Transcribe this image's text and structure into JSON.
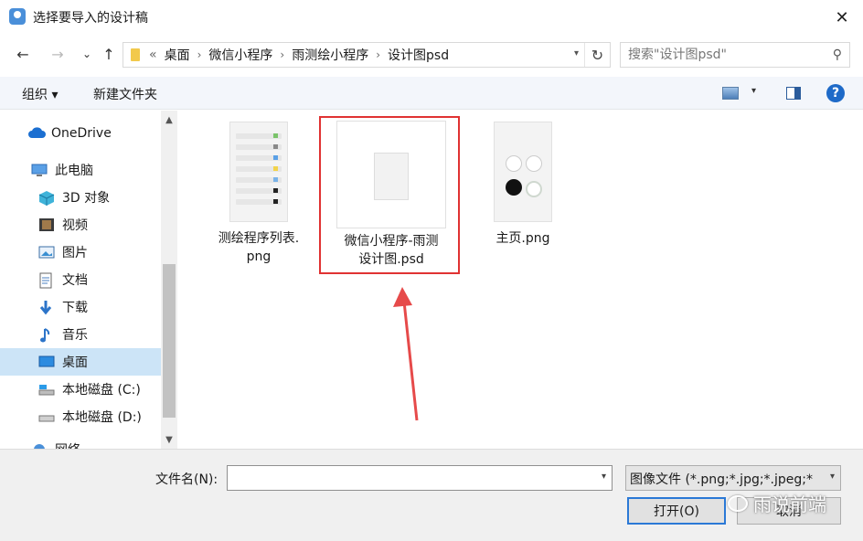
{
  "window": {
    "title": "选择要导入的设计稿",
    "close": "✕"
  },
  "nav": {
    "back": "←",
    "forward": "→",
    "recent": "⌄",
    "up": "↑",
    "overflow": "«",
    "path": [
      "桌面",
      "微信小程序",
      "雨测绘小程序",
      "设计图psd"
    ],
    "refresh": "↻",
    "search_placeholder": "搜索\"设计图psd\"",
    "search_icon": "⚲"
  },
  "toolbar": {
    "organize": "组织 ▾",
    "new_folder": "新建文件夹",
    "help": "?"
  },
  "sidebar": {
    "items": [
      {
        "label": "OneDrive",
        "icon": "cloud-icon"
      },
      {
        "label": "此电脑",
        "icon": "computer-icon"
      },
      {
        "label": "3D 对象",
        "icon": "cube-icon"
      },
      {
        "label": "视频",
        "icon": "video-icon"
      },
      {
        "label": "图片",
        "icon": "picture-icon"
      },
      {
        "label": "文档",
        "icon": "document-icon"
      },
      {
        "label": "下载",
        "icon": "download-icon"
      },
      {
        "label": "音乐",
        "icon": "music-icon"
      },
      {
        "label": "桌面",
        "icon": "desktop-icon"
      },
      {
        "label": "本地磁盘 (C:)",
        "icon": "drive-icon"
      },
      {
        "label": "本地磁盘 (D:)",
        "icon": "drive-icon"
      },
      {
        "label": "网络",
        "icon": "network-icon"
      }
    ],
    "selected_index": 8
  },
  "files": [
    {
      "name_line1": "测绘程序列表.",
      "name_line2": "png"
    },
    {
      "name_line1": "微信小程序-雨测",
      "name_line2": "设计图.psd"
    },
    {
      "name_line1": "主页.png",
      "name_line2": ""
    }
  ],
  "footer": {
    "filename_label": "文件名(N):",
    "filename_value": "",
    "filetype": "图像文件 (*.png;*.jpg;*.jpeg;*",
    "open": "打开(O)",
    "cancel": "取消"
  },
  "watermark": "雨说前端",
  "colors": {
    "highlight": "#e03232",
    "selected": "#cce4f7",
    "accent": "#1e6ac8"
  }
}
